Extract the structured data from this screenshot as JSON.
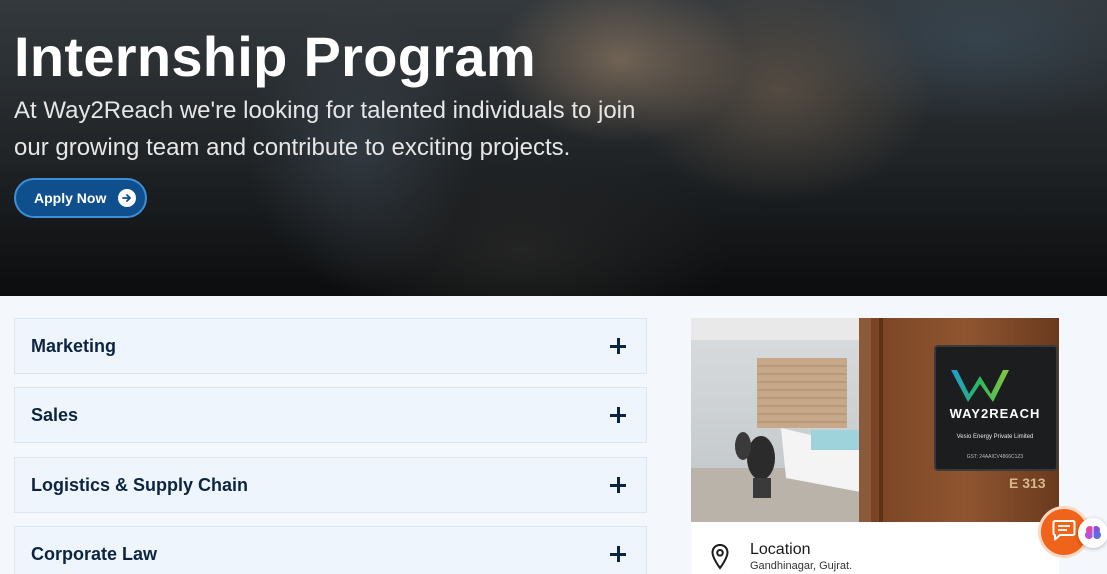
{
  "hero": {
    "title": "Internship Program",
    "subtitle": "At Way2Reach we're looking for talented individuals to join our growing team and contribute to exciting projects.",
    "apply_label": "Apply Now",
    "apply_icon": "arrow-right-circle-icon"
  },
  "departments": [
    {
      "title": "Marketing",
      "icon": "plus-icon"
    },
    {
      "title": "Sales",
      "icon": "plus-icon"
    },
    {
      "title": "Logistics & Supply Chain",
      "icon": "plus-icon"
    },
    {
      "title": "Corporate Law",
      "icon": "plus-icon"
    }
  ],
  "office_image": {
    "sign_brand": "way2reach",
    "sign_company": "Vesio Energy Private Limited",
    "sign_gst": "GST: 24AAICV4866C1Z3",
    "room_number": "E 313"
  },
  "location": {
    "title": "Location",
    "address": "Gandhinagar, Gujrat.",
    "icon": "map-pin-icon"
  },
  "colors": {
    "accent": "#0f4f8e",
    "chat": "#f0631a",
    "heading": "#0d2440"
  }
}
